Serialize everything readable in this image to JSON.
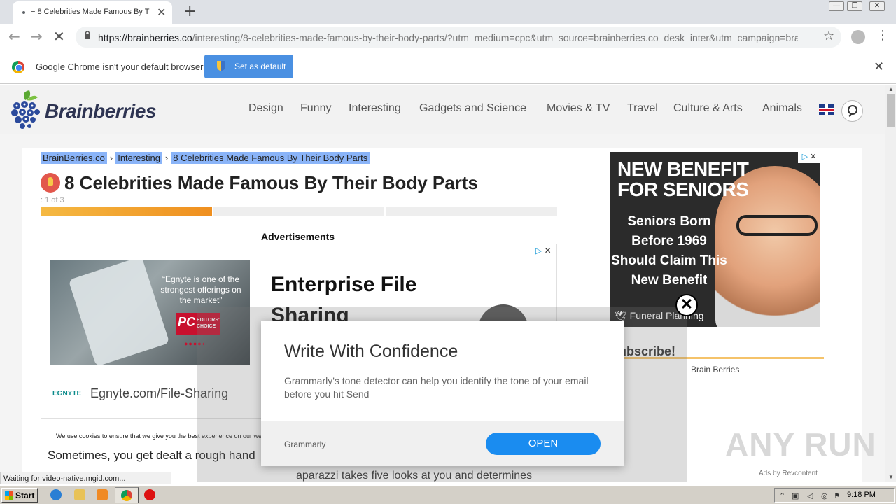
{
  "browser": {
    "tab_title": "≡ 8 Celebrities Made Famous By The",
    "new_tab_symbol": "+",
    "url_host": "https://brainberries.co",
    "url_path": "/interesting/8-celebrities-made-famous-by-their-body-parts/?utm_medium=cpc&utm_source=brainberries.co_desk_inter&utm_campaign=brai...",
    "infobar_text": "Google Chrome isn't your default browser",
    "set_default_label": "Set as default"
  },
  "site": {
    "logo_text": "Brainberries",
    "nav": [
      "Design",
      "Funny",
      "Interesting",
      "Gadgets and Science",
      "Movies & TV",
      "Travel",
      "Culture & Arts",
      "Animals"
    ]
  },
  "article": {
    "breadcrumb": [
      "BrainBerries.co",
      "Interesting",
      "8 Celebrities Made Famous By Their Body Parts"
    ],
    "title": "8 Celebrities Made Famous By Their Body Parts",
    "page_indicator": ": 1 of 3",
    "progress": {
      "current": 1,
      "total": 3
    },
    "ads_label": "Advertisements",
    "cookie_text": "We use cookies to ensure that we give you the best experience on our we",
    "body_text_1": "Sometimes, you get dealt a rough hand",
    "body_text_2": "aparazzi takes five looks at you and determines"
  },
  "ad_main": {
    "quote": "“Egnyte is one of the strongest offerings on the market”",
    "badge_pc": "PC",
    "badge_text": "EDITORS' CHOICE",
    "headline": "Enterprise File Sharing",
    "logo": "EGNYTE",
    "domain": "Egnyte.com/File-Sharing"
  },
  "side_ad": {
    "title": "NEW BENEFIT FOR SENIORS",
    "sub": "Seniors Born Before 1969 Should Claim This New Benefit",
    "brand": "Funeral Planning"
  },
  "sidebar": {
    "subscribe": "ubscribe!",
    "brain_berries": "Brain Berries",
    "ads_by": "Ads by Revcontent"
  },
  "watermark": "ANY RUN",
  "popup": {
    "title": "Write With Confidence",
    "body": "Grammarly's tone detector can help you identify the tone of your email before you hit Send",
    "brand": "Grammarly",
    "open_label": "OPEN"
  },
  "status_text": "Waiting for video-native.mgid.com...",
  "taskbar": {
    "start_label": "Start",
    "clock": "9:18 PM"
  },
  "colors": {
    "accent_blue": "#4a90e2",
    "open_button": "#1a8cf0",
    "progress_orange": "#ef8f1f",
    "breadcrumb_highlight": "#8ab4f8"
  }
}
